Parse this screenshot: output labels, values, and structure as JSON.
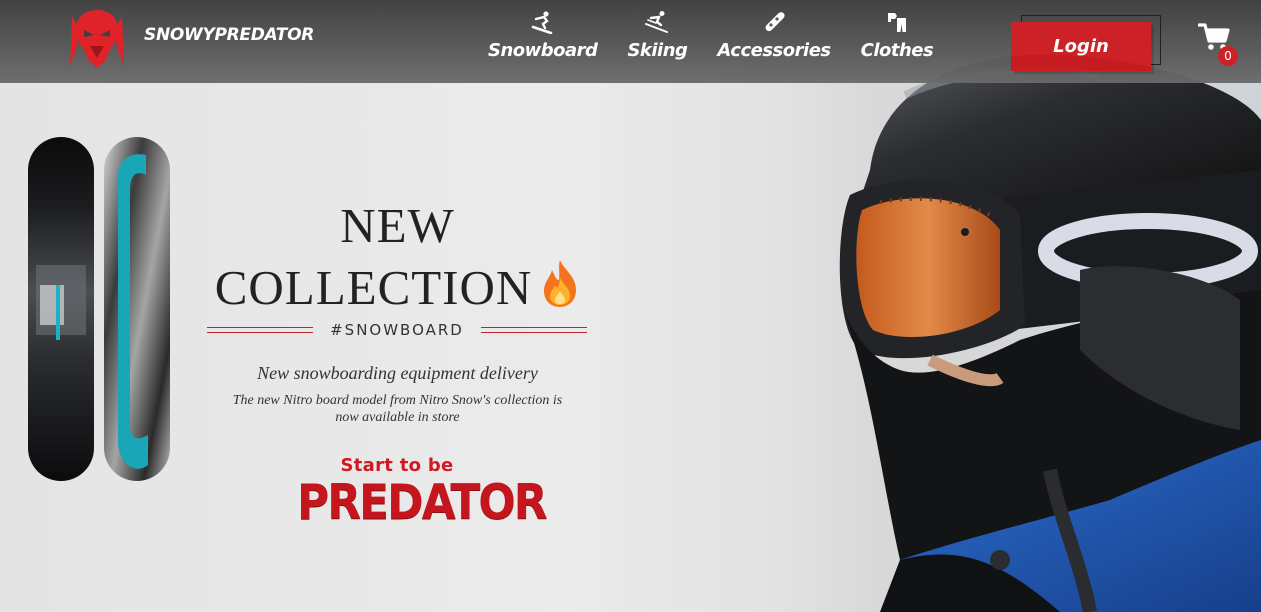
{
  "brand": {
    "name": "SNOWYPREDATOR",
    "logo": "predator-mask-logo"
  },
  "nav": {
    "items": [
      {
        "label": "Snowboard",
        "icon": "snowboarder-icon"
      },
      {
        "label": "Skiing",
        "icon": "skier-icon"
      },
      {
        "label": "Accessories",
        "icon": "snowboard-icon"
      },
      {
        "label": "Clothes",
        "icon": "clothes-icon"
      }
    ]
  },
  "header": {
    "login_label": "Login",
    "cart_count": "0"
  },
  "hero": {
    "headline_line1": "NEW",
    "headline_line2": "COLLECTION",
    "hashtag": "#SNOWBOARD",
    "subheading": "New snowboarding equipment delivery",
    "description": "The new Nitro board model from Nitro Snow's collection is now available in store",
    "cta_top": "Start to be",
    "cta_main": "PREDATOR"
  },
  "colors": {
    "accent": "#cc1a1f",
    "header": "#4a4a4a",
    "text": "#222222"
  }
}
